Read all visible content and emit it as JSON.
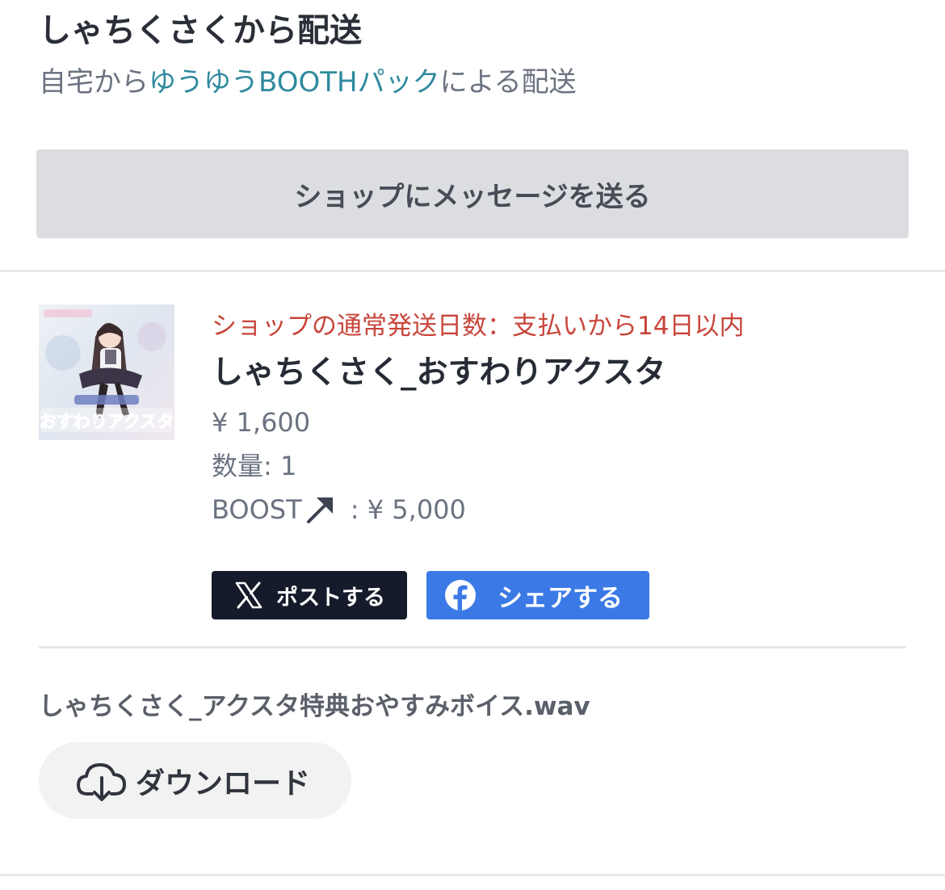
{
  "shop": {
    "title": "しゃちくさくから配送",
    "shipping_prefix": "自宅から",
    "shipping_method": "ゆうゆうBOOTHパック",
    "shipping_suffix": "による配送",
    "message_button": "ショップにメッセージを送る"
  },
  "item": {
    "shipping_days": "ショップの通常発送日数：支払いから14日以内",
    "name": "しゃちくさく_おすわりアクスタ",
    "price": "¥ 1,600",
    "quantity_label": "数量",
    "quantity_value": "1",
    "boost_label": "BOOST",
    "boost_value": "¥ 5,000",
    "thumbnail_caption": "おすわりアクスタ"
  },
  "share": {
    "x_label": "ポストする",
    "facebook_label": "シェアする"
  },
  "download": {
    "file_name": "しゃちくさく_アクスタ特典おやすみボイス.wav",
    "button_label": "ダウンロード"
  },
  "colors": {
    "link": "#2f8a9e",
    "shipping_days": "#c8453b",
    "x_button": "#151b2a",
    "facebook_button": "#3b7ae6",
    "message_button_bg": "#dcdde0"
  },
  "icons": {
    "boost": "arrow-up-right-icon",
    "x": "x-logo-icon",
    "facebook": "facebook-icon",
    "download": "cloud-download-icon"
  }
}
